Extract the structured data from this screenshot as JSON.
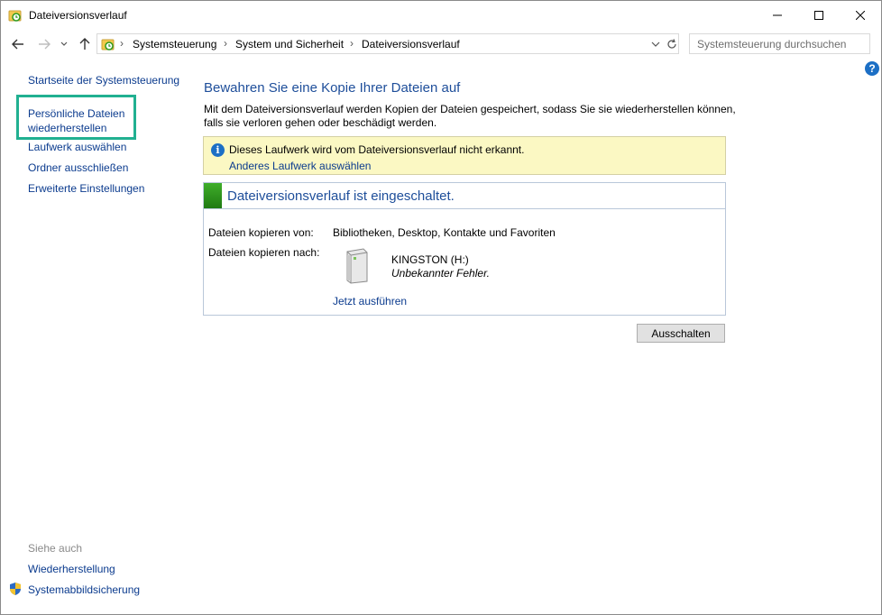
{
  "window": {
    "title": "Dateiversionsverlauf",
    "controls": {
      "minimize": "—",
      "maximize": "☐",
      "close": "✕"
    }
  },
  "address_bar": {
    "breadcrumb": [
      "Systemsteuerung",
      "System und Sicherheit",
      "Dateiversionsverlauf"
    ],
    "search_placeholder": "Systemsteuerung durchsuchen"
  },
  "help": {
    "label": "?"
  },
  "left_pane": {
    "home_link": "Startseite der Systemsteuerung",
    "links": [
      "Persönliche Dateien wiederherstellen",
      "Laufwerk auswählen",
      "Ordner ausschließen",
      "Erweiterte Einstellungen"
    ],
    "see_also_heading": "Siehe auch",
    "see_also": [
      "Wiederherstellung",
      "Systemabbildsicherung"
    ]
  },
  "main": {
    "title": "Bewahren Sie eine Kopie Ihrer Dateien auf",
    "description": "Mit dem Dateiversionsverlauf werden Kopien der Dateien gespeichert, sodass Sie sie wiederherstellen können, falls sie verloren gehen oder beschädigt werden.",
    "info": {
      "icon": "info-icon",
      "text": "Dieses Laufwerk wird vom Dateiversionsverlauf nicht erkannt.",
      "link": "Anderes Laufwerk auswählen"
    },
    "status": {
      "title": "Dateiversionsverlauf ist eingeschaltet.",
      "copy_from_label": "Dateien kopieren von:",
      "copy_from_value": "Bibliotheken, Desktop, Kontakte und Favoriten",
      "copy_to_label": "Dateien kopieren nach:",
      "drive_name": "KINGSTON (H:)",
      "drive_status": "Unbekannter Fehler.",
      "run_now": "Jetzt ausführen"
    },
    "turn_off_button": "Ausschalten"
  },
  "colors": {
    "link": "#0b3b8e",
    "heading": "#1e4e9a",
    "info_background": "#fbf8c3",
    "highlight_border": "#21b091",
    "status_green": "#2e9a1e"
  }
}
